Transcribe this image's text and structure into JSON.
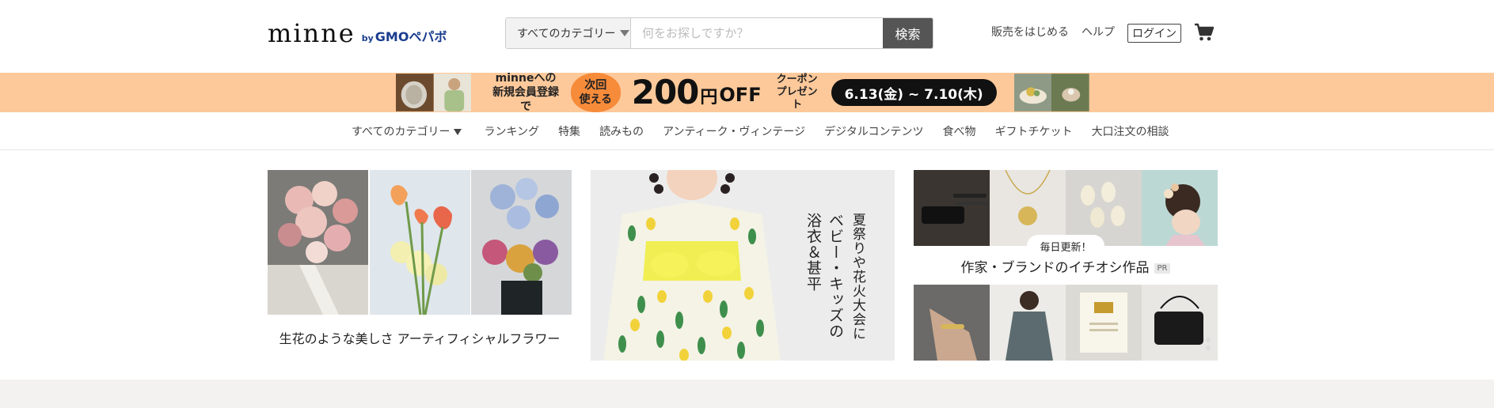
{
  "header": {
    "logo": {
      "word": "minne",
      "by": "by",
      "brand": "GMOペパボ"
    },
    "search": {
      "category": "すべてのカテゴリー",
      "placeholder": "何をお探しですか？",
      "button": "検索"
    },
    "nav": {
      "sell": "販売をはじめる",
      "help": "ヘルプ",
      "login": "ログイン"
    },
    "cart_icon": "cart-icon"
  },
  "promo_banner": {
    "line1": "minneへの",
    "line2": "新規会員登録で",
    "circle_line1": "次回",
    "circle_line2": "使える",
    "amount": "200",
    "unit": "円",
    "off": "OFF",
    "coupon_line1": "クーポン",
    "coupon_line2": "プレゼント",
    "dates": "6.13(金) ~ 7.10(木)",
    "colors": {
      "background": "#fdc99a",
      "circle": "#f68b3a",
      "dates_bg": "#111111"
    }
  },
  "category_nav": {
    "items": [
      "すべてのカテゴリー",
      "ランキング",
      "特集",
      "読みもの",
      "アンティーク・ヴィンテージ",
      "デジタルコンテンツ",
      "食べ物",
      "ギフトチケット",
      "大口注文の相談"
    ]
  },
  "features": {
    "card1": {
      "caption": "生花のような美しさ アーティフィシャルフラワー"
    },
    "card2": {
      "line1": "夏祭りや花火大会に",
      "line2": "ベビー・キッズの",
      "line3": "浴衣＆甚平"
    },
    "card3": {
      "badge": "毎日更新！",
      "title": "作家・ブランドのイチオシ作品",
      "pr": "PR"
    }
  }
}
